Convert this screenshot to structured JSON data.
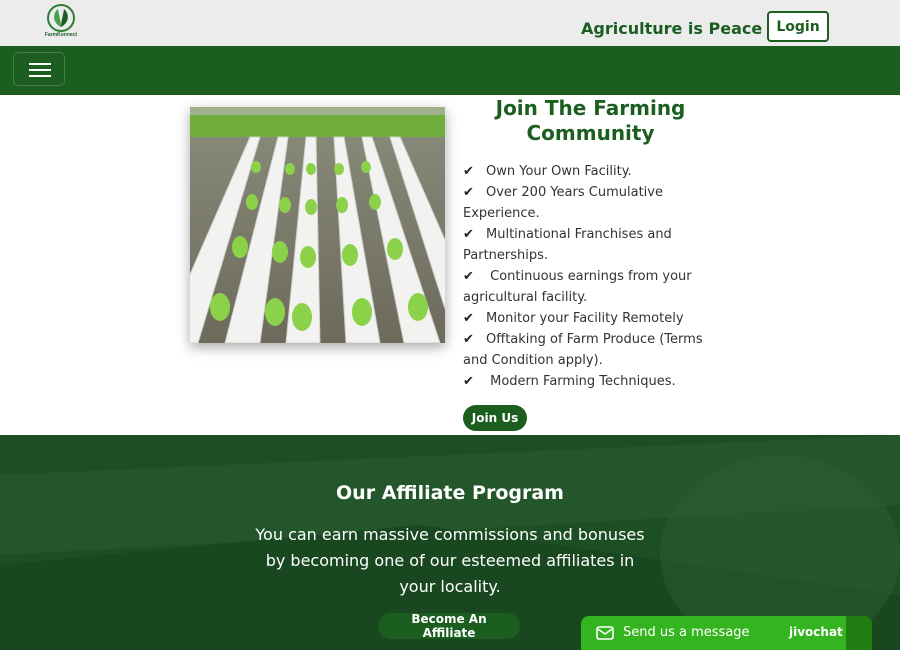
{
  "header": {
    "logo_text": "FarmKonnect",
    "tagline": "Agriculture is Peace",
    "login_label": "Login"
  },
  "navbar": {
    "toggler_icon": "hamburger-icon"
  },
  "community": {
    "title_line1": "Join The Farming",
    "title_line2": "Community",
    "features": [
      "Own Your Own Facility.",
      "Over 200 Years Cumulative Experience.",
      "Multinational Franchises and Partnerships.",
      " Continuous earnings from your agricultural facility.",
      "Monitor your Facility Remotely",
      "Offtaking of Farm Produce (Terms and Condition apply).",
      " Modern Farming Techniques."
    ],
    "join_label": "Join Us"
  },
  "affiliate": {
    "title": "Our Affiliate Program",
    "text": "You can earn massive commissions and bonuses by becoming one of our esteemed affiliates in your locality.",
    "button_label": "Become An Affiliate"
  },
  "chat": {
    "label": "Send us a message",
    "brand": "jivochat"
  },
  "colors": {
    "brand_green": "#1b5e20",
    "chat_green": "#34b51f",
    "topbar_bg": "#ececec"
  }
}
